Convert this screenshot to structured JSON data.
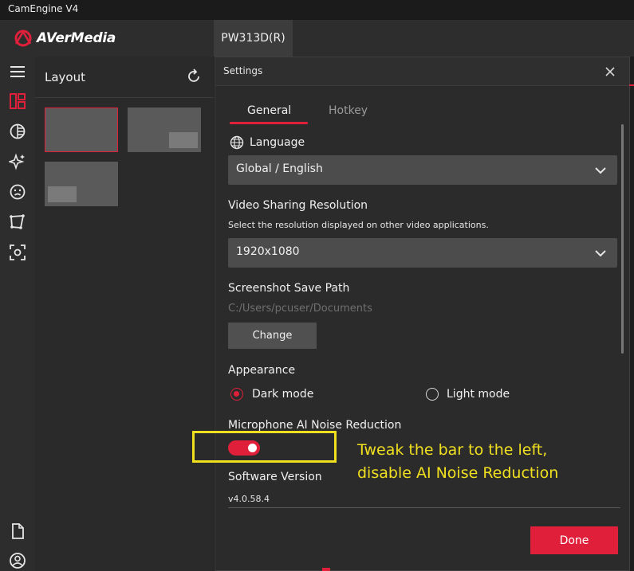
{
  "window": {
    "title": "CamEngine V4"
  },
  "brand": {
    "name": "AVerMedia",
    "accent": "#e0203a"
  },
  "device_tab": {
    "label": "PW313D(R)"
  },
  "iconbar": {
    "icons": [
      "menu-icon",
      "layout-icon",
      "color-icon",
      "effects-icon",
      "face-icon",
      "crop-icon",
      "screenshot-icon",
      "document-icon",
      "account-icon"
    ]
  },
  "layout_panel": {
    "title": "Layout"
  },
  "settings": {
    "title": "Settings",
    "tabs": [
      "General",
      "Hotkey"
    ],
    "language": {
      "label": "Language",
      "value": "Global / English"
    },
    "video_sharing": {
      "label": "Video Sharing Resolution",
      "description": "Select the resolution displayed on other video applications.",
      "value": "1920x1080"
    },
    "screenshot": {
      "label": "Screenshot Save Path",
      "path": "C:/Users/pcuser/Documents",
      "button": "Change"
    },
    "appearance": {
      "label": "Appearance",
      "options": [
        "Dark mode",
        "Light mode"
      ],
      "selected": "Dark mode"
    },
    "noise_reduction": {
      "label": "Microphone AI Noise Reduction",
      "enabled": true
    },
    "software_version": {
      "label": "Software Version",
      "value": "v4.0.58.4"
    },
    "done_button": "Done"
  },
  "annotation": {
    "line1": "Tweak the bar to the left,",
    "line2": "disable AI Noise Reduction",
    "color": "#f0e020"
  }
}
